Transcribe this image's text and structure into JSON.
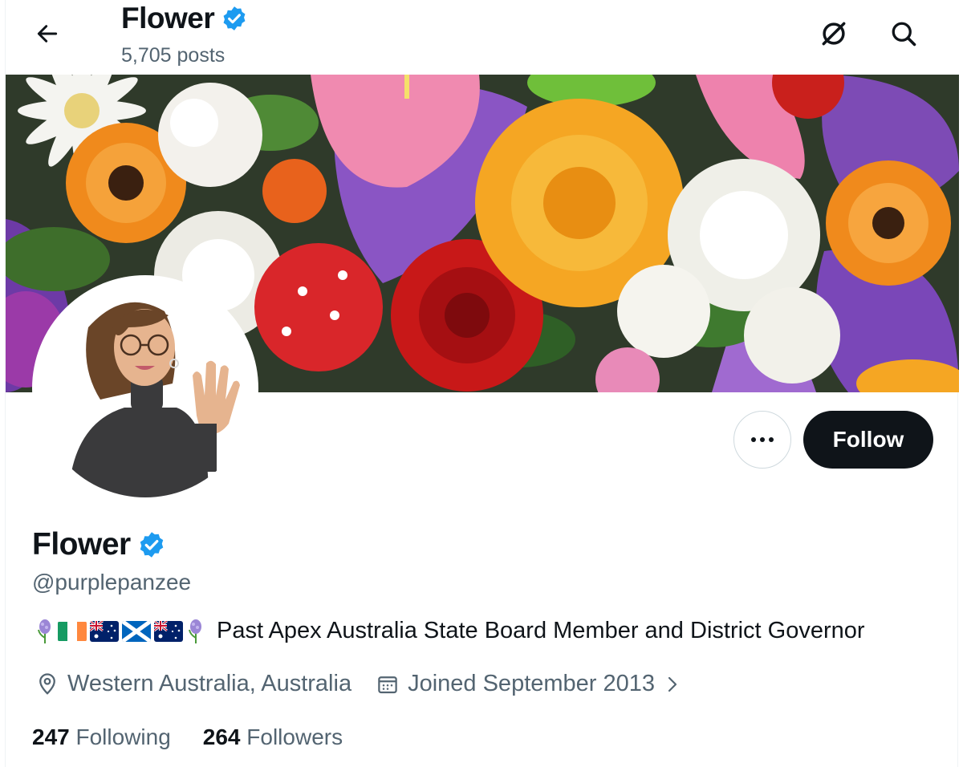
{
  "header": {
    "title": "Flower",
    "posts_count": "5,705 posts",
    "back_icon": "arrow-left-icon",
    "grok_icon": "circle-slash-icon",
    "search_icon": "search-icon"
  },
  "profile": {
    "display_name": "Flower",
    "handle": "@purplepanzee",
    "verified": true,
    "bio_text": "Past Apex Australia State Board Member and District Governor",
    "bio_emojis": [
      "hyacinth",
      "flag-ireland",
      "flag-australia",
      "flag-scotland",
      "flag-australia",
      "hyacinth"
    ],
    "location": "Western Australia, Australia",
    "joined": "Joined September 2013",
    "following_count": "247",
    "following_label": "Following",
    "followers_count": "264",
    "followers_label": "Followers"
  },
  "actions": {
    "follow_label": "Follow"
  },
  "colors": {
    "verified_blue": "#1d9bf0",
    "text_primary": "#0f1419",
    "text_secondary": "#536471",
    "follow_bg": "#0f1419"
  }
}
